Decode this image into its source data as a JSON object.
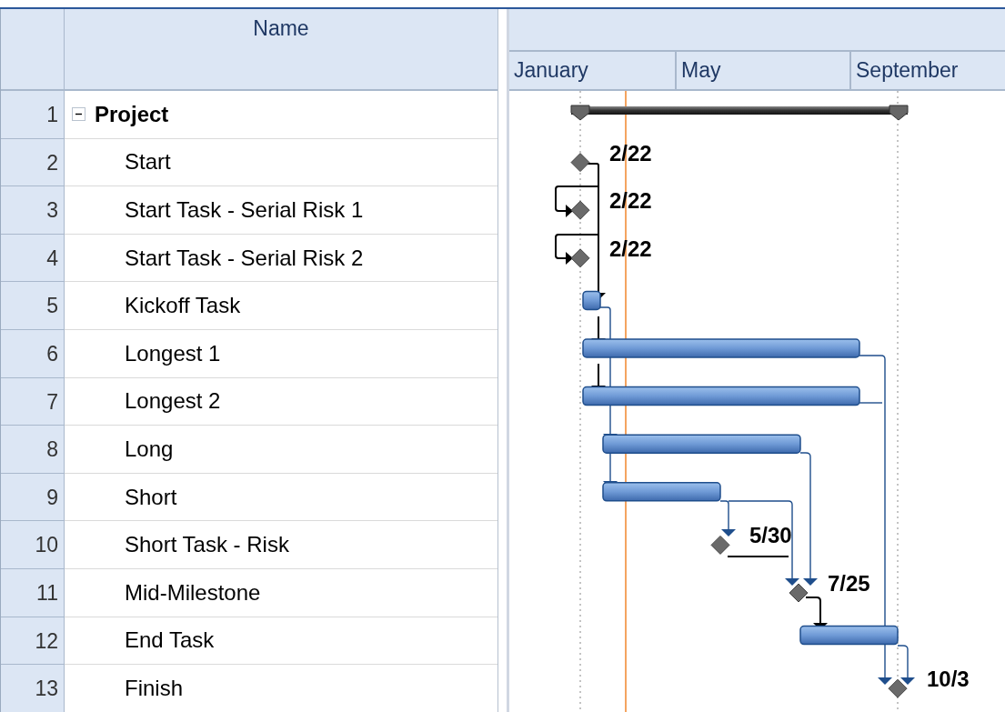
{
  "table": {
    "columns": [
      {
        "label": "Name"
      }
    ]
  },
  "timescale": {
    "months": [
      "January",
      "May",
      "September"
    ]
  },
  "tasks": [
    {
      "id": "1",
      "name": "Project",
      "kind": "summary",
      "expanded": true,
      "children": [
        {
          "id": "2",
          "name": "Start",
          "kind": "milestone",
          "date_label": "2/22"
        },
        {
          "id": "3",
          "name": "Start Task - Serial Risk 1",
          "kind": "milestone",
          "date_label": "2/22"
        },
        {
          "id": "4",
          "name": "Start Task - Serial Risk 2",
          "kind": "milestone",
          "date_label": "2/22"
        },
        {
          "id": "5",
          "name": "Kickoff Task",
          "kind": "task"
        },
        {
          "id": "6",
          "name": "Longest 1",
          "kind": "task"
        },
        {
          "id": "7",
          "name": "Longest 2",
          "kind": "task"
        },
        {
          "id": "8",
          "name": "Long",
          "kind": "task"
        },
        {
          "id": "9",
          "name": "Short",
          "kind": "task"
        },
        {
          "id": "10",
          "name": "Short Task - Risk",
          "kind": "milestone",
          "date_label": "5/30"
        },
        {
          "id": "11",
          "name": "Mid-Milestone",
          "kind": "milestone",
          "date_label": "7/25"
        },
        {
          "id": "12",
          "name": "End Task",
          "kind": "task"
        },
        {
          "id": "13",
          "name": "Finish",
          "kind": "milestone",
          "date_label": "10/3"
        }
      ]
    }
  ]
}
